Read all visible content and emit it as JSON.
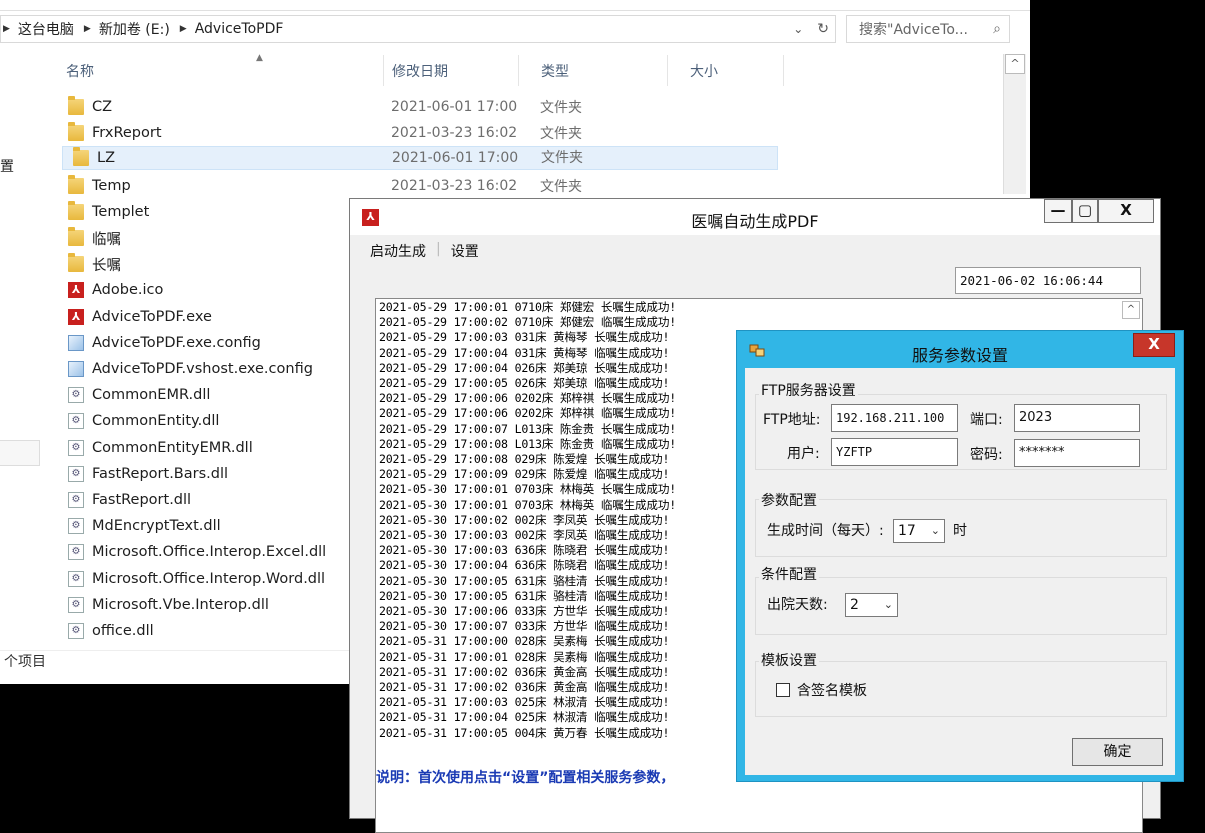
{
  "explorer": {
    "breadcrumb": [
      "这台电脑",
      "新加卷 (E:)",
      "AdviceToPDF"
    ],
    "search_placeholder": "搜索\"AdviceTo...",
    "columns": {
      "name": "名称",
      "date": "修改日期",
      "type": "类型",
      "size": "大小"
    },
    "rows": [
      {
        "name": "CZ",
        "date": "2021-06-01 17:00",
        "type": "文件夹",
        "icon": "folder-icon"
      },
      {
        "name": "FrxReport",
        "date": "2021-03-23 16:02",
        "type": "文件夹",
        "icon": "folder-icon"
      },
      {
        "name": "LZ",
        "date": "2021-06-01 17:00",
        "type": "文件夹",
        "icon": "folder-icon"
      },
      {
        "name": "Temp",
        "date": "2021-03-23 16:02",
        "type": "文件夹",
        "icon": "folder-icon"
      },
      {
        "name": "Templet",
        "icon": "folder-icon"
      },
      {
        "name": "临嘱",
        "icon": "folder-icon"
      },
      {
        "name": "长嘱",
        "icon": "folder-icon"
      },
      {
        "name": "Adobe.ico",
        "icon": "pdf-icon"
      },
      {
        "name": "AdviceToPDF.exe",
        "icon": "pdf-icon"
      },
      {
        "name": "AdviceToPDF.exe.config",
        "icon": "config-file-icon"
      },
      {
        "name": "AdviceToPDF.vshost.exe.config",
        "icon": "config-file-icon"
      },
      {
        "name": "CommonEMR.dll",
        "icon": "dll-file-icon"
      },
      {
        "name": "CommonEntity.dll",
        "icon": "dll-file-icon"
      },
      {
        "name": "CommonEntityEMR.dll",
        "icon": "dll-file-icon"
      },
      {
        "name": "FastReport.Bars.dll",
        "icon": "dll-file-icon"
      },
      {
        "name": "FastReport.dll",
        "icon": "dll-file-icon"
      },
      {
        "name": "MdEncryptText.dll",
        "icon": "dll-file-icon"
      },
      {
        "name": "Microsoft.Office.Interop.Excel.dll",
        "icon": "dll-file-icon"
      },
      {
        "name": "Microsoft.Office.Interop.Word.dll",
        "icon": "dll-file-icon"
      },
      {
        "name": "Microsoft.Vbe.Interop.dll",
        "icon": "dll-file-icon"
      },
      {
        "name": "office.dll",
        "icon": "dll-file-icon"
      }
    ],
    "nav_fragment": "置",
    "status_text": "个项目"
  },
  "main_window": {
    "title": "医嘱自动生成PDF",
    "menu": [
      "启动生成",
      "设置"
    ],
    "current_time": "2021-06-02 16:06:44",
    "log": [
      "2021-05-29 17:00:01 0710床 郑健宏 长嘱生成成功!",
      "2021-05-29 17:00:02 0710床 郑健宏 临嘱生成成功!",
      "2021-05-29 17:00:03 031床 黄梅琴 长嘱生成成功!",
      "2021-05-29 17:00:04 031床 黄梅琴 临嘱生成成功!",
      "2021-05-29 17:00:04 026床 郑美琼 长嘱生成成功!",
      "2021-05-29 17:00:05 026床 郑美琼 临嘱生成成功!",
      "2021-05-29 17:00:06 0202床 郑梓祺 长嘱生成成功!",
      "2021-05-29 17:00:06 0202床 郑梓祺 临嘱生成成功!",
      "2021-05-29 17:00:07 L013床 陈金贵 长嘱生成成功!",
      "2021-05-29 17:00:08 L013床 陈金贵 临嘱生成成功!",
      "2021-05-29 17:00:08 029床 陈爱煌 长嘱生成成功!",
      "2021-05-29 17:00:09 029床 陈爱煌 临嘱生成成功!",
      "2021-05-30 17:00:01 0703床 林梅英 长嘱生成成功!",
      "2021-05-30 17:00:01 0703床 林梅英 临嘱生成成功!",
      "2021-05-30 17:00:02 002床 李凤英 长嘱生成成功!",
      "2021-05-30 17:00:03 002床 李凤英 临嘱生成成功!",
      "2021-05-30 17:00:03 636床 陈晓君 长嘱生成成功!",
      "2021-05-30 17:00:04 636床 陈晓君 临嘱生成成功!",
      "2021-05-30 17:00:05 631床 骆桂清 长嘱生成成功!",
      "2021-05-30 17:00:05 631床 骆桂清 临嘱生成成功!",
      "2021-05-30 17:00:06 033床 方世华 长嘱生成成功!",
      "2021-05-30 17:00:07 033床 方世华 临嘱生成成功!",
      "2021-05-31 17:00:00 028床 吴素梅 长嘱生成成功!",
      "2021-05-31 17:00:01 028床 吴素梅 临嘱生成成功!",
      "2021-05-31 17:00:02 036床 黄金高 长嘱生成成功!",
      "2021-05-31 17:00:02 036床 黄金高 临嘱生成成功!",
      "2021-05-31 17:00:03 025床 林淑清 长嘱生成成功!",
      "2021-05-31 17:00:04 025床 林淑清 临嘱生成成功!",
      "2021-05-31 17:00:05 004床 黄万春 长嘱生成成功!"
    ],
    "notice": "说明：首次使用点击“设置”配置相关服务参数，"
  },
  "dialog": {
    "title": "服务参数设置",
    "ftp_group": "FTP服务器设置",
    "ftp_addr_label": "FTP地址:",
    "ftp_addr_value": "192.168.211.100",
    "port_label": "端口:",
    "port_value": "2023",
    "user_label": "用户:",
    "user_value": "YZFTP",
    "pwd_label": "密码:",
    "pwd_value": "*******",
    "param_group": "参数配置",
    "gen_time_label": "生成时间（每天）:",
    "gen_time_value": "17",
    "hour_unit": "时",
    "cond_group": "条件配置",
    "discharge_days_label": "出院天数:",
    "discharge_days_value": "2",
    "tpl_group": "模板设置",
    "signature_label": "含签名模板",
    "signature_checked": false,
    "ok_label": "确定"
  }
}
